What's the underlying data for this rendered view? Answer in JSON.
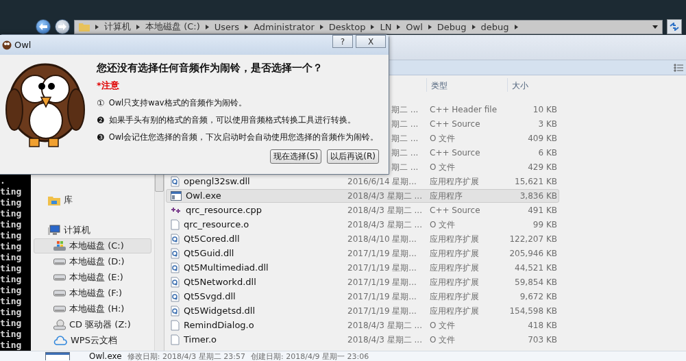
{
  "address_bar": {
    "crumbs": [
      "计算机",
      "本地磁盘 (C:)",
      "Users",
      "Administrator",
      "Desktop",
      "LN",
      "Owl",
      "Debug",
      "debug"
    ]
  },
  "console": {
    "lines": [
      ".",
      "ting",
      "ting",
      "ting",
      "ting",
      "ting",
      "ting",
      "ting",
      "ting",
      "ting",
      "ting",
      "ting",
      "ting",
      "ting",
      "ting",
      "ting"
    ]
  },
  "nav": {
    "items": [
      {
        "label": "库",
        "kind": "library",
        "selected": false,
        "gap": true
      },
      {
        "label": "计算机",
        "kind": "computer",
        "selected": false,
        "gap": true
      },
      {
        "label": "本地磁盘 (C:)",
        "kind": "system-drive",
        "selected": true
      },
      {
        "label": "本地磁盘 (D:)",
        "kind": "drive",
        "selected": false
      },
      {
        "label": "本地磁盘 (E:)",
        "kind": "drive",
        "selected": false
      },
      {
        "label": "本地磁盘 (F:)",
        "kind": "drive",
        "selected": false
      },
      {
        "label": "本地磁盘 (H:)",
        "kind": "drive",
        "selected": false
      },
      {
        "label": "CD 驱动器 (Z:)",
        "kind": "cd",
        "selected": false
      },
      {
        "label": "WPS云文档",
        "kind": "cloud",
        "selected": false
      }
    ]
  },
  "file_list": {
    "columns": [
      "类型",
      "大小"
    ],
    "rows": [
      {
        "kind": "partial",
        "date": "期二 ...",
        "type": "C++ Header file",
        "size": "10 KB",
        "selected": false
      },
      {
        "kind": "partial",
        "date": "期二 ...",
        "type": "C++ Source",
        "size": "3 KB",
        "selected": false
      },
      {
        "kind": "partial",
        "date": "期二 ...",
        "type": "O 文件",
        "size": "409 KB",
        "selected": false
      },
      {
        "kind": "partial",
        "date": "期二 ...",
        "type": "C++ Source",
        "size": "6 KB",
        "selected": false
      },
      {
        "kind": "partial",
        "date": "期二 ...",
        "type": "O 文件",
        "size": "429 KB",
        "selected": false
      },
      {
        "kind": "dll",
        "name": "opengl32sw.dll",
        "date": "2016/6/14 星期...",
        "type": "应用程序扩展",
        "size": "15,621 KB",
        "selected": false
      },
      {
        "kind": "exe",
        "name": "Owl.exe",
        "date": "2018/4/3 星期二 ...",
        "type": "应用程序",
        "size": "3,836 KB",
        "selected": true
      },
      {
        "kind": "cpp",
        "name": "qrc_resource.cpp",
        "date": "2018/4/3 星期二 ...",
        "type": "C++ Source",
        "size": "491 KB",
        "selected": false
      },
      {
        "kind": "o",
        "name": "qrc_resource.o",
        "date": "2018/4/3 星期二 ...",
        "type": "O 文件",
        "size": "99 KB",
        "selected": false
      },
      {
        "kind": "dll",
        "name": "Qt5Cored.dll",
        "date": "2018/4/10 星期...",
        "type": "应用程序扩展",
        "size": "122,207 KB",
        "selected": false
      },
      {
        "kind": "dll",
        "name": "Qt5Guid.dll",
        "date": "2017/1/19 星期...",
        "type": "应用程序扩展",
        "size": "205,946 KB",
        "selected": false
      },
      {
        "kind": "dll",
        "name": "Qt5Multimediad.dll",
        "date": "2017/1/19 星期...",
        "type": "应用程序扩展",
        "size": "44,521 KB",
        "selected": false
      },
      {
        "kind": "dll",
        "name": "Qt5Networkd.dll",
        "date": "2017/1/19 星期...",
        "type": "应用程序扩展",
        "size": "59,854 KB",
        "selected": false
      },
      {
        "kind": "dll",
        "name": "Qt5Svgd.dll",
        "date": "2017/1/19 星期...",
        "type": "应用程序扩展",
        "size": "9,672 KB",
        "selected": false
      },
      {
        "kind": "dll",
        "name": "Qt5Widgetsd.dll",
        "date": "2017/1/19 星期...",
        "type": "应用程序扩展",
        "size": "154,598 KB",
        "selected": false
      },
      {
        "kind": "o",
        "name": "RemindDialog.o",
        "date": "2018/4/3 星期二 ...",
        "type": "O 文件",
        "size": "418 KB",
        "selected": false
      },
      {
        "kind": "o",
        "name": "Timer.o",
        "date": "2018/4/3 星期二 ...",
        "type": "O 文件",
        "size": "703 KB",
        "selected": false
      }
    ]
  },
  "details": {
    "name": "Owl.exe",
    "modified": "修改日期: 2018/4/3 星期二 23:57",
    "created": "创建日期: 2018/4/9 星期一 23:06"
  },
  "dialog": {
    "title": "Owl",
    "help": "?",
    "close": "X",
    "heading": "您还没有选择任何音频作为闹铃，是否选择一个？",
    "note": "*注意",
    "items": [
      {
        "mark": "①",
        "text": "Owl只支持wav格式的音频作为闹铃。"
      },
      {
        "mark": "❷",
        "text": "如果手头有别的格式的音频，可以使用音频格式转换工具进行转换。"
      },
      {
        "mark": "❸",
        "text": "Owl会记住您选择的音频，下次启动时会自动使用您选择的音频作为闹铃。"
      }
    ],
    "buttons": [
      "现在选择(S)",
      "以后再说(R)"
    ]
  }
}
